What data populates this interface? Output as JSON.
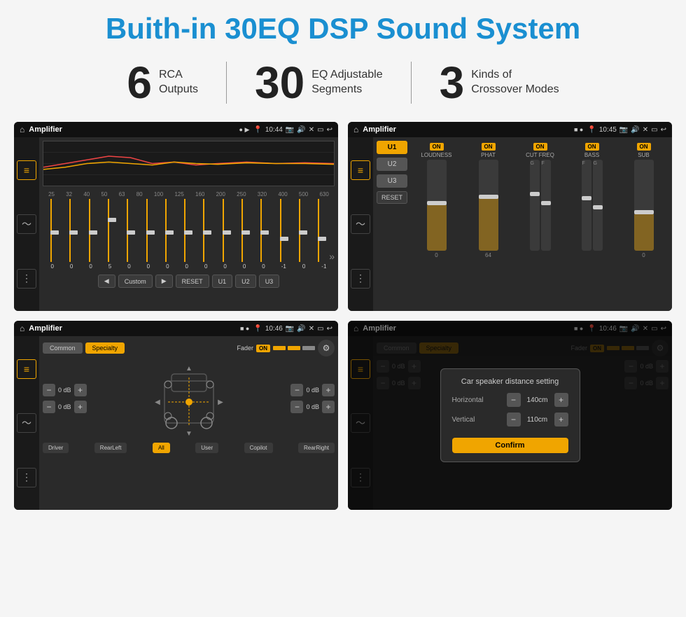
{
  "header": {
    "title": "Buith-in 30EQ DSP Sound System"
  },
  "stats": [
    {
      "number": "6",
      "label_line1": "RCA",
      "label_line2": "Outputs"
    },
    {
      "number": "30",
      "label_line1": "EQ Adjustable",
      "label_line2": "Segments"
    },
    {
      "number": "3",
      "label_line1": "Kinds of",
      "label_line2": "Crossover Modes"
    }
  ],
  "screens": {
    "eq": {
      "app_name": "Amplifier",
      "time": "10:44",
      "freq_labels": [
        "25",
        "32",
        "40",
        "50",
        "63",
        "80",
        "100",
        "125",
        "160",
        "200",
        "250",
        "320",
        "400",
        "500",
        "630"
      ],
      "values": [
        "0",
        "0",
        "0",
        "5",
        "0",
        "0",
        "0",
        "0",
        "0",
        "0",
        "0",
        "0",
        "-1",
        "0",
        "-1"
      ],
      "buttons": [
        "◀",
        "Custom",
        "▶",
        "RESET",
        "U1",
        "U2",
        "U3"
      ]
    },
    "crossover": {
      "app_name": "Amplifier",
      "time": "10:45",
      "presets": [
        "U1",
        "U2",
        "U3"
      ],
      "channels": [
        {
          "on": true,
          "label": "LOUDNESS"
        },
        {
          "on": true,
          "label": "PHAT"
        },
        {
          "on": true,
          "label": "CUT FREQ"
        },
        {
          "on": true,
          "label": "BASS"
        },
        {
          "on": true,
          "label": "SUB"
        }
      ],
      "reset_label": "RESET"
    },
    "fader": {
      "app_name": "Amplifier",
      "time": "10:46",
      "modes": [
        "Common",
        "Specialty"
      ],
      "active_mode": "Specialty",
      "fader_label": "Fader",
      "on_label": "ON",
      "left_db": [
        "0 dB",
        "0 dB"
      ],
      "right_db": [
        "0 dB",
        "0 dB"
      ],
      "bottom_btns": [
        "Driver",
        "RearLeft",
        "All",
        "User",
        "Copilot",
        "RearRight"
      ]
    },
    "dialog": {
      "app_name": "Amplifier",
      "time": "10:46",
      "title": "Car speaker distance setting",
      "horizontal_label": "Horizontal",
      "horizontal_value": "140cm",
      "vertical_label": "Vertical",
      "vertical_value": "110cm",
      "confirm_label": "Confirm",
      "right_db_values": [
        "0 dB",
        "0 dB"
      ],
      "bottom_btns": [
        "Driver",
        "RearLeft",
        "All",
        "User",
        "Copilot",
        "RearRight"
      ]
    }
  }
}
